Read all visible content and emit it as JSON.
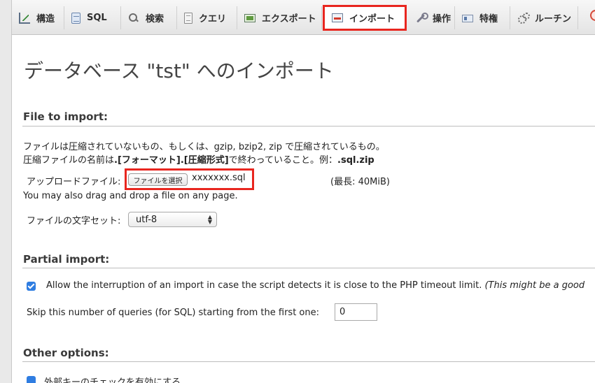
{
  "tabs": [
    {
      "label": "構造",
      "icon": "structure-icon"
    },
    {
      "label": "SQL",
      "icon": "sql-icon"
    },
    {
      "label": "検索",
      "icon": "search-icon"
    },
    {
      "label": "クエリ",
      "icon": "query-icon"
    },
    {
      "label": "エクスポート",
      "icon": "export-icon"
    },
    {
      "label": "インポート",
      "icon": "import-icon",
      "active": true
    },
    {
      "label": "操作",
      "icon": "operations-icon"
    },
    {
      "label": "特権",
      "icon": "privileges-icon"
    },
    {
      "label": "ルーチン",
      "icon": "routines-icon"
    }
  ],
  "page_title": "データベース \"tst\" へのインポート",
  "file_to_import": {
    "heading": "File to import:",
    "desc_line1": "ファイルは圧縮されていないもの、もしくは、gzip, bzip2, zip で圧縮されているもの。",
    "desc_line2_prefix": "圧縮ファイルの名前は",
    "desc_line2_bold1": ".[フォーマット].[圧縮形式]",
    "desc_line2_middle": "で終わっていること。例：",
    "desc_line2_bold2": ".sql.zip",
    "upload_label": "アップロードファイル:",
    "choose_file_button": "ファイルを選択",
    "chosen_file": "xxxxxxx.sql",
    "max_size": "(最長: 40MiB)",
    "drag_note": "You may also drag and drop a file on any page.",
    "charset_label": "ファイルの文字セット:",
    "charset_value": "utf-8"
  },
  "partial_import": {
    "heading": "Partial import:",
    "allow_interrupt_label": "Allow the interruption of an import in case the script detects it is close to the PHP timeout limit.",
    "allow_interrupt_note": "(This might be a good",
    "allow_interrupt_checked": true,
    "skip_label": "Skip this number of queries (for SQL) starting from the first one:",
    "skip_value": "0"
  },
  "other_options": {
    "heading": "Other options:",
    "foreign_key_label": "外部キーのチェックを有効にする"
  },
  "colors": {
    "highlight": "#e8261f",
    "checkbox": "#2f7de1"
  }
}
